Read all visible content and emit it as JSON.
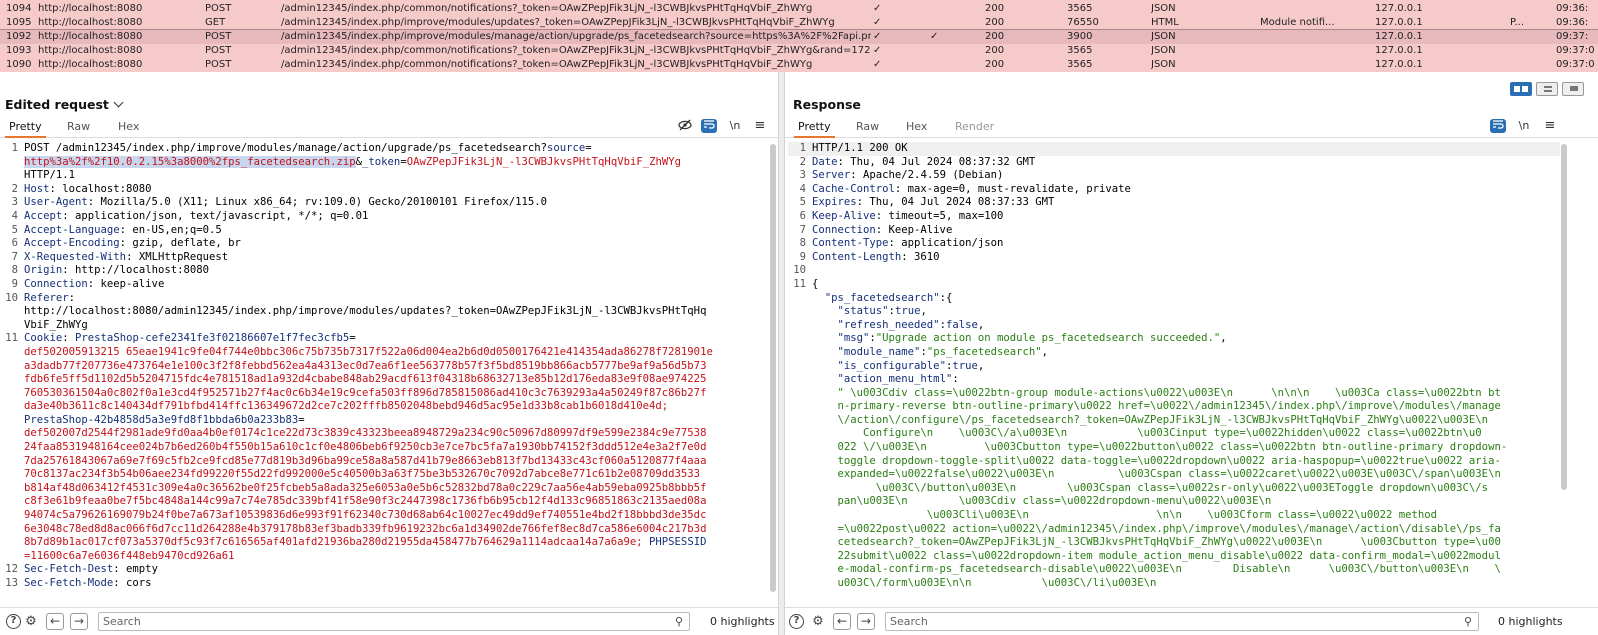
{
  "history": [
    {
      "id": "1094",
      "host": "http://localhost:8080",
      "method": "POST",
      "url": "/admin12345/index.php/common/notifications?_token=OAwZPepJFik3LjN_-l3CWBJkvsPHtTqHqVbiF_ZhWYg",
      "edited": "✓",
      "params": "",
      "status": "200",
      "length": "3565",
      "mime": "JSON",
      "title": "",
      "ip": "127.0.0.1",
      "extra": "",
      "time": "09:36:",
      "selected": false
    },
    {
      "id": "1095",
      "host": "http://localhost:8080",
      "method": "GET",
      "url": "/admin12345/index.php/improve/modules/updates?_token=OAwZPepJFik3LjN_-l3CWBJkvsPHtTqHqVbiF_ZhWYg",
      "edited": "✓",
      "params": "",
      "status": "200",
      "length": "76550",
      "mime": "HTML",
      "title": "Module notifi...",
      "ip": "127.0.0.1",
      "extra": "P...",
      "time": "09:36:",
      "selected": false
    },
    {
      "id": "1092",
      "host": "http://localhost:8080",
      "method": "POST",
      "url": "/admin12345/index.php/improve/modules/manage/action/upgrade/ps_facetedsearch?source=https%3A%2F%2Fapi.pr...",
      "edited": "✓",
      "params": "✓",
      "status": "200",
      "length": "3900",
      "mime": "JSON",
      "title": "",
      "ip": "127.0.0.1",
      "extra": "",
      "time": "09:37:",
      "selected": true
    },
    {
      "id": "1093",
      "host": "http://localhost:8080",
      "method": "POST",
      "url": "/admin12345/index.php/common/notifications?_token=OAwZPepJFik3LjN_-l3CWBJkvsPHtTqHqVbiF_ZhWYg&rand=172...",
      "edited": "✓",
      "params": "",
      "status": "200",
      "length": "3565",
      "mime": "JSON",
      "title": "",
      "ip": "127.0.0.1",
      "extra": "",
      "time": "09:37:0",
      "selected": false
    },
    {
      "id": "1090",
      "host": "http://localhost:8080",
      "method": "POST",
      "url": "/admin12345/index.php/common/notifications?_token=OAwZPepJFik3LjN_-l3CWBJkvsPHtTqHqVbiF_ZhWYg",
      "edited": "✓",
      "params": "",
      "status": "200",
      "length": "3565",
      "mime": "JSON",
      "title": "",
      "ip": "127.0.0.1",
      "extra": "",
      "time": "09:37:0",
      "selected": false
    }
  ],
  "request": {
    "title": "Edited request",
    "tabs": [
      "Pretty",
      "Raw",
      "Hex"
    ],
    "icons": {
      "hide": "⊘",
      "wrap": "≡",
      "newline": "\\n",
      "menu": "≡"
    },
    "lines": [
      {
        "n": "1",
        "parts": [
          {
            "t": "POST /admin12345/index.php/improve/modules/manage/action/upgrade/ps_facetedsearch?",
            "c": "cont"
          },
          {
            "t": "source",
            "c": "hdrk"
          },
          {
            "t": "=",
            "c": "cont"
          }
        ]
      },
      {
        "n": "",
        "parts": [
          {
            "t": "http%3a%2f%2f10.0.2.15%3a8000%2fps_facetedsearch.zip",
            "c": "sel-hl"
          },
          {
            "t": "&",
            "c": "cont"
          },
          {
            "t": "_token",
            "c": "hdrk"
          },
          {
            "t": "=",
            "c": "cont"
          },
          {
            "t": "OAwZPepJFik3LjN_-l3CWBJkvsPHtTqHqVbiF_ZhWYg",
            "c": "red"
          }
        ]
      },
      {
        "n": "",
        "parts": [
          {
            "t": "HTTP/1.1",
            "c": "cont"
          }
        ]
      },
      {
        "n": "2",
        "parts": [
          {
            "t": "Host",
            "c": "hdrk"
          },
          {
            "t": ": localhost:8080",
            "c": "cont"
          }
        ]
      },
      {
        "n": "3",
        "parts": [
          {
            "t": "User-Agent",
            "c": "hdrk"
          },
          {
            "t": ": Mozilla/5.0 (X11; Linux x86_64; rv:109.0) Gecko/20100101 Firefox/115.0",
            "c": "cont"
          }
        ]
      },
      {
        "n": "4",
        "parts": [
          {
            "t": "Accept",
            "c": "hdrk"
          },
          {
            "t": ": application/json, text/javascript, */*; q=0.01",
            "c": "cont"
          }
        ]
      },
      {
        "n": "5",
        "parts": [
          {
            "t": "Accept-Language",
            "c": "hdrk"
          },
          {
            "t": ": en-US,en;q=0.5",
            "c": "cont"
          }
        ]
      },
      {
        "n": "6",
        "parts": [
          {
            "t": "Accept-Encoding",
            "c": "hdrk"
          },
          {
            "t": ": gzip, deflate, br",
            "c": "cont"
          }
        ]
      },
      {
        "n": "7",
        "parts": [
          {
            "t": "X-Requested-With",
            "c": "hdrk"
          },
          {
            "t": ": XMLHttpRequest",
            "c": "cont"
          }
        ]
      },
      {
        "n": "8",
        "parts": [
          {
            "t": "Origin",
            "c": "hdrk"
          },
          {
            "t": ": http://localhost:8080",
            "c": "cont"
          }
        ]
      },
      {
        "n": "9",
        "parts": [
          {
            "t": "Connection",
            "c": "hdrk"
          },
          {
            "t": ": keep-alive",
            "c": "cont"
          }
        ]
      },
      {
        "n": "10",
        "parts": [
          {
            "t": "Referer",
            "c": "hdrk"
          },
          {
            "t": ":",
            "c": "cont"
          }
        ]
      },
      {
        "n": "",
        "parts": [
          {
            "t": "http://localhost:8080/admin12345/index.php/improve/modules/updates?_token=OAwZPepJFik3LjN_-l3CWBJkvsPHtTqHq",
            "c": "cont"
          }
        ]
      },
      {
        "n": "",
        "parts": [
          {
            "t": "VbiF_ZhWYg",
            "c": "cont"
          }
        ]
      },
      {
        "n": "11",
        "parts": [
          {
            "t": "Cookie",
            "c": "hdrk"
          },
          {
            "t": ": ",
            "c": "cont"
          },
          {
            "t": "PrestaShop-cefe2341fe3f02186607e1f7fec3cfb5",
            "c": "hdrk"
          },
          {
            "t": "=",
            "c": "cont"
          }
        ]
      },
      {
        "n": "",
        "parts": [
          {
            "t": "def502005913215 65eae1941c9fe04f744e0bbc306c75b735b7317f522a06d004ea2b6d0d0500176421e414354ada86278f7281901e",
            "c": "red"
          }
        ]
      },
      {
        "n": "",
        "parts": [
          {
            "t": "a3dadb77f207736e473764e1e100c3f2f8febbd562ea4a4313ec0d7ea6f1ee563778b57f3f5bd8519bb866acb5777be9af9a56d5b73",
            "c": "red"
          }
        ]
      },
      {
        "n": "",
        "parts": [
          {
            "t": "fdb6fe5ff5d1102d5b5204715fdc4e781518ad1a932d4cbabe848ab29acdf613f04318b68632713e85b12d176eda83e9f08ae974225",
            "c": "red"
          }
        ]
      },
      {
        "n": "",
        "parts": [
          {
            "t": "760530361504a0c802f0a1e3cd4f952571b27f4ac0c6b34e19c9cefa503ff896d785815086ad410c3c7639293a4a50249f87c86b27f",
            "c": "red"
          }
        ]
      },
      {
        "n": "",
        "parts": [
          {
            "t": "da3e40b3611c8c140434df791bfbd414ffc136349672d2ce7c202fffb8502048bebd946d5ac95e1d33b8cab1b6018d410e4d;",
            "c": "red"
          }
        ]
      },
      {
        "n": "",
        "parts": [
          {
            "t": "PrestaShop-42b4858d5a3e9fd8f1bbda6b0a233b83",
            "c": "hdrk"
          },
          {
            "t": "=",
            "c": "cont"
          }
        ]
      },
      {
        "n": "",
        "parts": [
          {
            "t": "def502007d2544f2981ade9fd0aa4b0ef0174c1ce22d73c3839c43323beea8948729a234c90c50967d80997df9e599e2384c9e77538",
            "c": "red"
          }
        ]
      },
      {
        "n": "",
        "parts": [
          {
            "t": "24faa8531948164cee024b7b6ed260b4f550b15a610c1cf0e4806beb6f9250cb3e7ce7bc5fa7a1930bb74152f3ddd512e4e3a2f7e0d",
            "c": "red"
          }
        ]
      },
      {
        "n": "",
        "parts": [
          {
            "t": "7da25761843067a69e7f69c5fb2ce9fcd85e77d819b3d96ba99ce58a8a587d41b79e8663eb813f7bd13433c43cf060a5120877f4aaa",
            "c": "red"
          }
        ]
      },
      {
        "n": "",
        "parts": [
          {
            "t": "70c8137ac234f3b54b06aee234fd99220f55d22fd992000e5c40500b3a63f75be3b532670c7092d7abce8e771c61b2e08709dd3533",
            "c": "red"
          }
        ]
      },
      {
        "n": "",
        "parts": [
          {
            "t": "b814af48d063412f4531c309e4a0c36562be0f25fcbeb5a8ada325e6053a0e5b6c52832bd78a0c229c7aa56e4ab59eba0925b8bbb5f",
            "c": "red"
          }
        ]
      },
      {
        "n": "",
        "parts": [
          {
            "t": "c8f3e61b9feaa0be7f5bc4848a144c99a7c74e785dc339bf41f58e90f3c2447398c1736fb6b95cb12f4d133c96851863c2135aed08a",
            "c": "red"
          }
        ]
      },
      {
        "n": "",
        "parts": [
          {
            "t": "94074c5a79626169079b24f0be7a673af10539836d6e993f91f62340c730d68ab64c10027ec49dd9ef740551e4bd2f18bbbd3de35dc",
            "c": "red"
          }
        ]
      },
      {
        "n": "",
        "parts": [
          {
            "t": "6e3048c78ed8d8ac066f6d7cc11d264288e4b379178b83ef3badb339fb9619232bc6a1d34902de766fef8ec8d7ca586e6004c217b3d",
            "c": "red"
          }
        ]
      },
      {
        "n": "",
        "parts": [
          {
            "t": "8b7d89b1ac017cf073a5370df5c93f7c616565af401afd21936ba280d21955da458477b764629a1114adcaa14a7a6a9e; ",
            "c": "red"
          },
          {
            "t": "PHPSESSID",
            "c": "hdrk"
          }
        ]
      },
      {
        "n": "",
        "parts": [
          {
            "t": "=11600c6a7e6036f448eb9470cd926a61",
            "c": "red"
          }
        ]
      },
      {
        "n": "12",
        "parts": [
          {
            "t": "Sec-Fetch-Dest",
            "c": "hdrk"
          },
          {
            "t": ": empty",
            "c": "cont"
          }
        ]
      },
      {
        "n": "13",
        "parts": [
          {
            "t": "Sec-Fetch-Mode",
            "c": "hdrk"
          },
          {
            "t": ": cors",
            "c": "cont"
          }
        ]
      }
    ]
  },
  "response": {
    "title": "Response",
    "tabs": [
      "Pretty",
      "Raw",
      "Hex",
      "Render"
    ],
    "icons": {
      "wrap": "≡",
      "newline": "\\n",
      "menu": "≡"
    },
    "lines": [
      {
        "n": "1",
        "parts": [
          {
            "t": "HTTP/1.1 200 OK",
            "c": "cont"
          }
        ],
        "cursor": true
      },
      {
        "n": "2",
        "parts": [
          {
            "t": "Date",
            "c": "hdrk"
          },
          {
            "t": ": Thu, 04 Jul 2024 08:37:32 GMT",
            "c": "cont"
          }
        ]
      },
      {
        "n": "3",
        "parts": [
          {
            "t": "Server",
            "c": "hdrk"
          },
          {
            "t": ": Apache/2.4.59 (Debian)",
            "c": "cont"
          }
        ]
      },
      {
        "n": "4",
        "parts": [
          {
            "t": "Cache-Control",
            "c": "hdrk"
          },
          {
            "t": ": max-age=0, must-revalidate, private",
            "c": "cont"
          }
        ]
      },
      {
        "n": "5",
        "parts": [
          {
            "t": "Expires",
            "c": "hdrk"
          },
          {
            "t": ": Thu, 04 Jul 2024 08:37:33 GMT",
            "c": "cont"
          }
        ]
      },
      {
        "n": "6",
        "parts": [
          {
            "t": "Keep-Alive",
            "c": "hdrk"
          },
          {
            "t": ": timeout=5, max=100",
            "c": "cont"
          }
        ]
      },
      {
        "n": "7",
        "parts": [
          {
            "t": "Connection",
            "c": "hdrk"
          },
          {
            "t": ": Keep-Alive",
            "c": "cont"
          }
        ]
      },
      {
        "n": "8",
        "parts": [
          {
            "t": "Content-Type",
            "c": "hdrk"
          },
          {
            "t": ": application/json",
            "c": "cont"
          }
        ]
      },
      {
        "n": "9",
        "parts": [
          {
            "t": "Content-Length",
            "c": "hdrk"
          },
          {
            "t": ": 3610",
            "c": "cont"
          }
        ]
      },
      {
        "n": "10",
        "parts": [
          {
            "t": "",
            "c": "cont"
          }
        ]
      },
      {
        "n": "11",
        "parts": [
          {
            "t": "{",
            "c": "cont"
          }
        ]
      },
      {
        "n": "",
        "parts": [
          {
            "t": "  ",
            "c": "cont"
          },
          {
            "t": "\"ps_facetedsearch\"",
            "c": "jkey"
          },
          {
            "t": ":{",
            "c": "cont"
          }
        ]
      },
      {
        "n": "",
        "parts": [
          {
            "t": "    ",
            "c": "cont"
          },
          {
            "t": "\"status\"",
            "c": "jkey"
          },
          {
            "t": ":",
            "c": "cont"
          },
          {
            "t": "true",
            "c": "jlit"
          },
          {
            "t": ",",
            "c": "cont"
          }
        ]
      },
      {
        "n": "",
        "parts": [
          {
            "t": "    ",
            "c": "cont"
          },
          {
            "t": "\"refresh_needed\"",
            "c": "jkey"
          },
          {
            "t": ":",
            "c": "cont"
          },
          {
            "t": "false",
            "c": "jlit"
          },
          {
            "t": ",",
            "c": "cont"
          }
        ]
      },
      {
        "n": "",
        "parts": [
          {
            "t": "    ",
            "c": "cont"
          },
          {
            "t": "\"msg\"",
            "c": "jkey"
          },
          {
            "t": ":",
            "c": "cont"
          },
          {
            "t": "\"Upgrade action on module ps_facetedsearch succeeded.\"",
            "c": "jstr"
          },
          {
            "t": ",",
            "c": "cont"
          }
        ]
      },
      {
        "n": "",
        "parts": [
          {
            "t": "    ",
            "c": "cont"
          },
          {
            "t": "\"module_name\"",
            "c": "jkey"
          },
          {
            "t": ":",
            "c": "cont"
          },
          {
            "t": "\"ps_facetedsearch\"",
            "c": "jstr"
          },
          {
            "t": ",",
            "c": "cont"
          }
        ]
      },
      {
        "n": "",
        "parts": [
          {
            "t": "    ",
            "c": "cont"
          },
          {
            "t": "\"is_configurable\"",
            "c": "jkey"
          },
          {
            "t": ":",
            "c": "cont"
          },
          {
            "t": "true",
            "c": "jlit"
          },
          {
            "t": ",",
            "c": "cont"
          }
        ]
      },
      {
        "n": "",
        "parts": [
          {
            "t": "    ",
            "c": "cont"
          },
          {
            "t": "\"action_menu_html\"",
            "c": "jkey"
          },
          {
            "t": ":",
            "c": "cont"
          }
        ]
      },
      {
        "n": "",
        "parts": [
          {
            "t": "    \" \\u003Cdiv class=\\u0022btn-group module-actions\\u0022\\u003E\\n      \\n\\n\\n    \\u003Ca class=\\u0022btn bt",
            "c": "jstr"
          }
        ]
      },
      {
        "n": "",
        "parts": [
          {
            "t": "    n-primary-reverse btn-outline-primary\\u0022 href=\\u0022\\/admin12345\\/index.php\\/improve\\/modules\\/manage",
            "c": "jstr"
          }
        ]
      },
      {
        "n": "",
        "parts": [
          {
            "t": "    \\/action\\/configure\\/ps_facetedsearch?_token=OAwZPepJFik3LjN_-l3CWBJkvsPHtTqHqVbiF_ZhWYg\\u0022\\u003E\\n",
            "c": "jstr"
          }
        ]
      },
      {
        "n": "",
        "parts": [
          {
            "t": "        Configure\\n    \\u003C\\/a\\u003E\\n           \\u003Cinput type=\\u0022hidden\\u0022 class=\\u0022btn\\u0",
            "c": "jstr"
          }
        ]
      },
      {
        "n": "",
        "parts": [
          {
            "t": "    022 \\/\\u003E\\n         \\u003Cbutton type=\\u0022button\\u0022 class=\\u0022btn btn-outline-primary dropdown-",
            "c": "jstr"
          }
        ]
      },
      {
        "n": "",
        "parts": [
          {
            "t": "    toggle dropdown-toggle-split\\u0022 data-toggle=\\u0022dropdown\\u0022 aria-haspopup=\\u0022true\\u0022 aria-",
            "c": "jstr"
          }
        ]
      },
      {
        "n": "",
        "parts": [
          {
            "t": "    expanded=\\u0022false\\u0022\\u003E\\n          \\u003Cspan class=\\u0022caret\\u0022\\u003E\\u003C\\/span\\u003E\\n",
            "c": "jstr"
          }
        ]
      },
      {
        "n": "",
        "parts": [
          {
            "t": "          \\u003C\\/button\\u003E\\n        \\u003Cspan class=\\u0022sr-only\\u0022\\u003EToggle dropdown\\u003C\\/s",
            "c": "jstr"
          }
        ]
      },
      {
        "n": "",
        "parts": [
          {
            "t": "    pan\\u003E\\n        \\u003Cdiv class=\\u0022dropdown-menu\\u0022\\u003E\\n",
            "c": "jstr"
          }
        ]
      },
      {
        "n": "",
        "parts": [
          {
            "t": "                  \\u003Cli\\u003E\\n                    \\n\\n    \\u003Cform class=\\u0022\\u0022 method",
            "c": "jstr"
          }
        ]
      },
      {
        "n": "",
        "parts": [
          {
            "t": "    =\\u0022post\\u0022 action=\\u0022\\/admin12345\\/index.php\\/improve\\/modules\\/manage\\/action\\/disable\\/ps_fa",
            "c": "jstr"
          }
        ]
      },
      {
        "n": "",
        "parts": [
          {
            "t": "    cetedsearch?_token=OAwZPepJFik3LjN_-l3CWBJkvsPHtTqHqVbiF_ZhWYg\\u0022\\u003E\\n      \\u003Cbutton type=\\u00",
            "c": "jstr"
          }
        ]
      },
      {
        "n": "",
        "parts": [
          {
            "t": "    22submit\\u0022 class=\\u0022dropdown-item module_action_menu_disable\\u0022 data-confirm_modal=\\u0022modul",
            "c": "jstr"
          }
        ]
      },
      {
        "n": "",
        "parts": [
          {
            "t": "    e-modal-confirm-ps_facetedsearch-disable\\u0022\\u003E\\n        Disable\\n      \\u003C\\/button\\u003E\\n    \\",
            "c": "jstr"
          }
        ]
      },
      {
        "n": "",
        "parts": [
          {
            "t": "    u003C\\/form\\u003E\\n\\n           \\u003C\\/li\\u003E\\n",
            "c": "jstr"
          }
        ]
      }
    ]
  },
  "bottom": {
    "search_placeholder": "Search",
    "highlights_label": "0 highlights"
  }
}
